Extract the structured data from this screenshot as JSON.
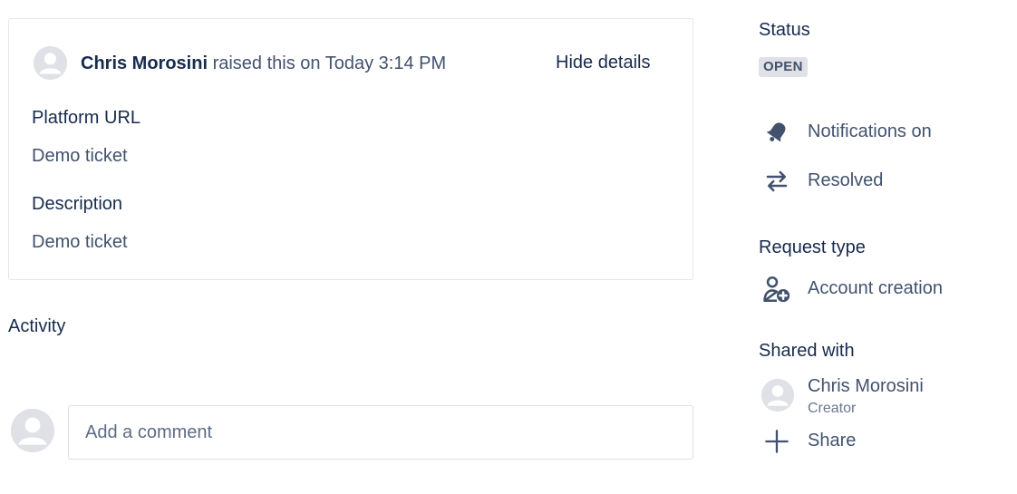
{
  "ticket": {
    "reporter_name": "Chris Morosini",
    "raised_text": "raised this on Today 3:14 PM",
    "hide_details_label": "Hide details",
    "fields": [
      {
        "label": "Platform URL",
        "value": "Demo ticket"
      },
      {
        "label": "Description",
        "value": "Demo ticket"
      }
    ]
  },
  "activity": {
    "title": "Activity",
    "comment_placeholder": "Add a comment"
  },
  "sidebar": {
    "status_heading": "Status",
    "status_value": "OPEN",
    "notifications_label": "Notifications on",
    "notifications_icon": "bell-icon",
    "resolved_label": "Resolved",
    "resolved_icon": "transition-arrows-icon",
    "request_type_heading": "Request type",
    "request_type_value": "Account creation",
    "request_type_icon": "user-add-icon",
    "shared_with_heading": "Shared with",
    "shared_person_name": "Chris Morosini",
    "shared_person_role": "Creator",
    "share_label": "Share",
    "share_icon": "plus-icon"
  },
  "colors": {
    "text_primary": "#172b4d",
    "text_secondary": "#42526e",
    "lozenge_bg": "#dfe1e6",
    "border": "#dfe1e6"
  }
}
